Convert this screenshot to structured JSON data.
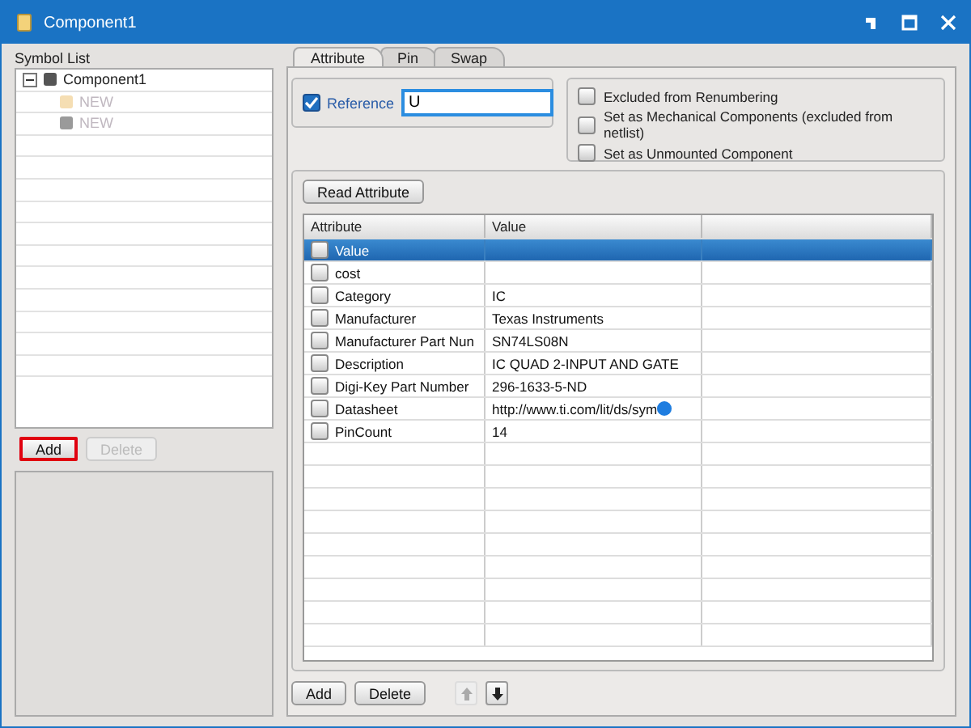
{
  "window": {
    "title": "Component1"
  },
  "symbol_list": {
    "label": "Symbol List",
    "items": [
      {
        "label": "Component1",
        "expanded": true,
        "disabled": false,
        "color": "#555555",
        "children": [
          {
            "label": "NEW",
            "disabled": true,
            "color": "#f5deb3"
          },
          {
            "label": "NEW",
            "disabled": true,
            "color": "#9a9a9a"
          }
        ]
      }
    ],
    "buttons": [
      {
        "label": "Add",
        "disabled": false,
        "highlighted": true
      },
      {
        "label": "Delete",
        "disabled": true,
        "highlighted": false
      }
    ]
  },
  "tabs": [
    {
      "label": "Attribute",
      "selected": true
    },
    {
      "label": "Pin",
      "selected": false
    },
    {
      "label": "Swap",
      "selected": false
    }
  ],
  "reference": {
    "label": "Reference",
    "checked": true,
    "value": "U"
  },
  "options": [
    {
      "label": "Excluded from Renumbering",
      "checked": false
    },
    {
      "label": "Set as Mechanical Components (excluded from netlist)",
      "checked": false
    },
    {
      "label": "Set as Unmounted Component",
      "checked": false
    }
  ],
  "read_button": "Read Attribute",
  "table": {
    "columns": [
      "Attribute",
      "Value"
    ],
    "rows": [
      {
        "attribute": "Value",
        "value": "",
        "checked": false,
        "selected": true
      },
      {
        "attribute": "cost",
        "value": "",
        "checked": false,
        "selected": false
      },
      {
        "attribute": "Category",
        "value": "IC",
        "checked": false,
        "selected": false
      },
      {
        "attribute": "Manufacturer",
        "value": "Texas Instruments",
        "checked": false,
        "selected": false
      },
      {
        "attribute": "Manufacturer Part Nun",
        "value": "SN74LS08N",
        "checked": false,
        "selected": false
      },
      {
        "attribute": "Description",
        "value": "IC QUAD 2-INPUT AND GATE",
        "checked": false,
        "selected": false
      },
      {
        "attribute": "Digi-Key Part Number",
        "value": "296-1633-5-ND",
        "checked": false,
        "selected": false
      },
      {
        "attribute": "Datasheet",
        "value": "http://www.ti.com/lit/ds/sym",
        "checked": false,
        "selected": false
      },
      {
        "attribute": "PinCount",
        "value": "14",
        "checked": false,
        "selected": false
      }
    ]
  },
  "bottom_buttons": [
    {
      "label": "Add",
      "disabled": false
    },
    {
      "label": "Delete",
      "disabled": false
    }
  ],
  "move_buttons": [
    {
      "kind": "up",
      "disabled": true
    },
    {
      "kind": "down",
      "disabled": false
    }
  ]
}
